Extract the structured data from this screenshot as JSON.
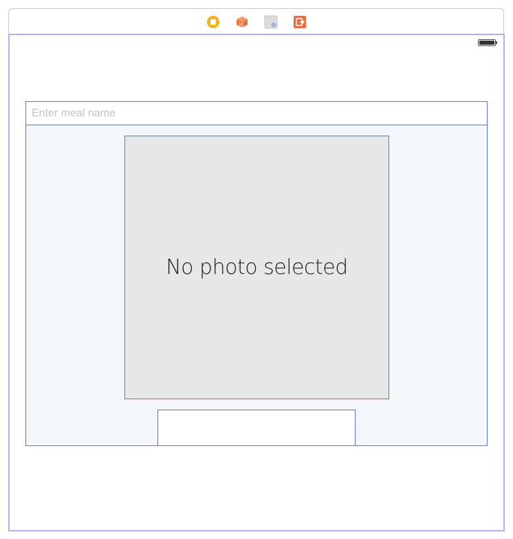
{
  "scene_dock": {
    "icons": [
      {
        "name": "view-controller-icon",
        "color": "#f5b21b"
      },
      {
        "name": "first-responder-icon",
        "color": "#e8743b"
      },
      {
        "name": "tap-gesture-recognizer-icon",
        "color": "#4a90d9"
      },
      {
        "name": "exit-icon",
        "color": "#ec6a3c"
      }
    ]
  },
  "status_bar": {
    "battery_level": 1.0
  },
  "form": {
    "meal_name_placeholder": "Enter meal name",
    "meal_name_value": "",
    "photo_placeholder": "No photo selected"
  },
  "colors": {
    "selection_outline": "#5b72d6",
    "canvas_border": "#a9b4e8",
    "stack_background": "#f3f6fb",
    "photo_background": "#e6e7e7"
  }
}
